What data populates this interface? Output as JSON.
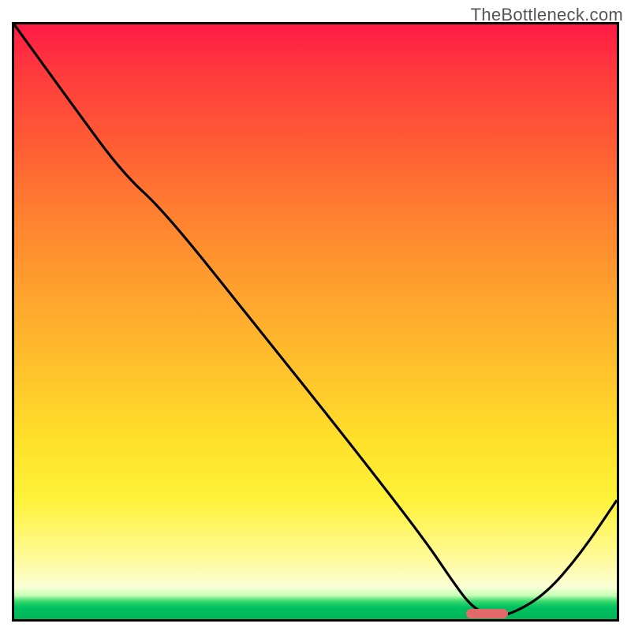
{
  "watermark": "TheBottleneck.com",
  "colors": {
    "curve": "#000000",
    "marker": "#e46a6a",
    "border": "#000000"
  },
  "chart_data": {
    "type": "line",
    "title": "",
    "xlabel": "",
    "ylabel": "",
    "xlim": [
      0,
      100
    ],
    "ylim": [
      0,
      100
    ],
    "grid": false,
    "series": [
      {
        "name": "bottleneck_curve",
        "x": [
          0,
          10,
          18,
          25,
          40,
          55,
          68,
          73,
          76,
          79,
          82,
          88,
          94,
          100
        ],
        "y": [
          100,
          86,
          75,
          68.5,
          49.5,
          30.5,
          13.5,
          6,
          2,
          0.6,
          0.6,
          4,
          11,
          20
        ]
      }
    ],
    "optimal_marker": {
      "x_start": 75,
      "x_end": 82,
      "y": 0.9,
      "thickness_pct": 1.6
    },
    "legend": false
  }
}
